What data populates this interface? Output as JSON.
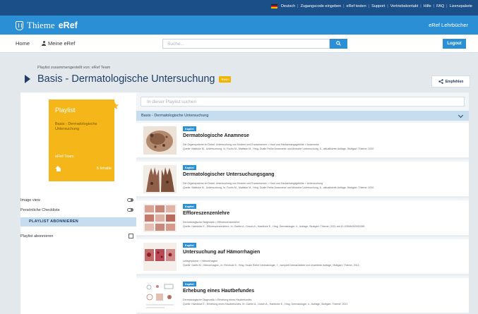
{
  "util": {
    "lang": "Deutsch",
    "links": [
      "Zugangscode eingeben",
      "eRef testen",
      "Support",
      "Vertriebskontakt",
      "Hilfe",
      "FAQ",
      "Lizenzpakete"
    ],
    "sep": "|"
  },
  "brand": {
    "thieme": "Thieme",
    "eref": "eRef",
    "right": "eRef Lehrbücher"
  },
  "nav": {
    "home": "Home",
    "meine": "Meine eRef",
    "search_placeholder": "Suche...",
    "logout": "Logout"
  },
  "header": {
    "compiled": "Playlist zusammengestellt von: eRef Team",
    "title": "Basis - Dermatologische Untersuchung",
    "badge": "Basis",
    "share": "Empfehlen"
  },
  "card": {
    "title": "Playlist",
    "subtitle": "Basis - Dermatologische Untersuchung",
    "author": "eRef Team",
    "count": "5 Inhalte"
  },
  "sidebar": {
    "image_view": "Image view",
    "checklist": "Persönliche Checkliste",
    "subscribe_head": "PLAYLIST ABONNIEREN",
    "subscribe": "Playlist abonnieren"
  },
  "content": {
    "search_placeholder": "In dieser Playlist suchen",
    "section": "Basis - Dermatologische Untersuchung",
    "kapitel": "Kapitel",
    "items": [
      {
        "title": "Dermatologische Anamnese",
        "path": "Die Organsysteme im Detail: Untersuchung von Kindern und Erwachsenen > Haut und Hautanhangsgebilde > Anamnese",
        "src": "Quelle: Mattiske M., Untersuchung, In: Fuchs M., Mattiske M., Hrsg. Duale Reihe Anamnese und klinische Untersuchung, 6., aktualisierte Auflage, Stuttgart: Thieme; 2020"
      },
      {
        "title": "Dermatologischer Untersuchungsgang",
        "path": "Die Organsysteme im Detail: Untersuchung von Kindern und Erwachsenen > Haut und Hautanhangsgebilde > Untersuchung",
        "src": "Quelle: Mattiske M., Untersuchung, In: Fuchs M., Mattiske M., Hrsg. Duale Reihe Anamnese und klinische Untersuchung, 6., aktualisierte Auflage, Stuttgart: Thieme; 2020"
      },
      {
        "title": "Effloreszenzenlehre",
        "path": "Dermatologische Diagnostik > Effloreszenzenlehre",
        "src": "Quelle: Haedicke E., Effloreszenzenlehre, In: Gaebe A., Dosch A., Haedicke E., Hrsg. Dermatologie, 4., Auflage, Stuttgart: Thieme; 2021 doi:10.1055/b000000285"
      },
      {
        "title": "Untersuchung auf Hämorrhagien",
        "path": "Leitsymptome > Hämorrhagien",
        "src": "Quelle: Gallin M., Hämorrhagien, In: Reinhold S., Hrsg. Duale Reihe Dermatologie, 7., komplett überarbeitete und erweiterte Auflage, Stuttgart: Thieme; 2013"
      },
      {
        "title": "Erhebung eines Hautbefundes",
        "path": "Dermatologische Diagnostik > Erhebung eines Hautbefundes",
        "src": "Quelle: Haedicke E., Erhebung eines Hautbefundes, In: Gaebe A., Dosch A., Haedicke E., Hrsg. Dermatologie, 4., Auflage, Stuttgart: Thieme; 2021"
      }
    ]
  },
  "colors": {
    "utilbar": "#1b4f87",
    "brand": "#2b8fd6",
    "accent_yellow": "#f4b619",
    "section": "#c6dcef"
  }
}
